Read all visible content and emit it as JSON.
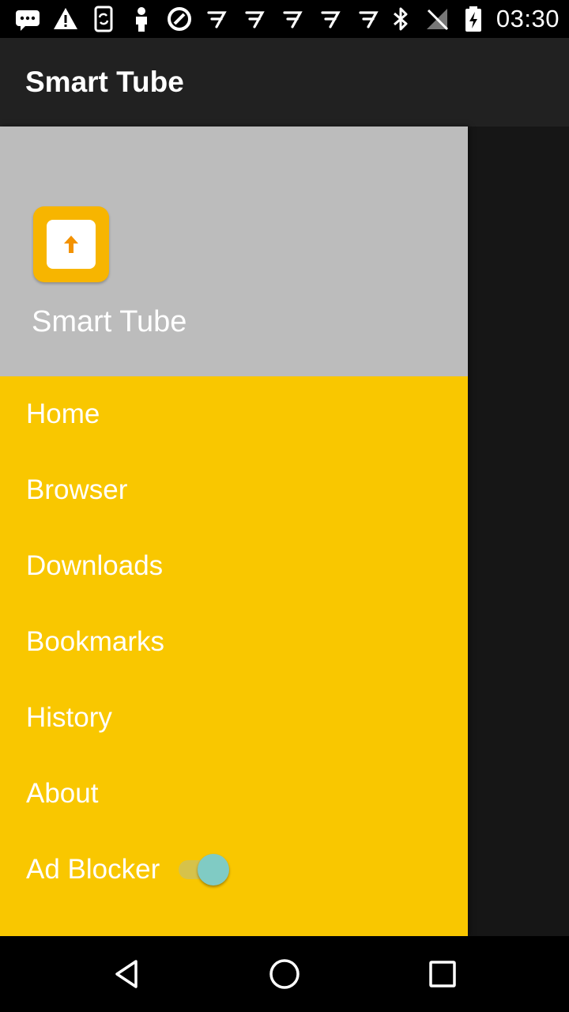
{
  "status_bar": {
    "time": "03:30",
    "left_icons": [
      "message-icon",
      "warning-icon",
      "phone-sync-icon",
      "person-icon",
      "blocked-icon",
      "notification-7-icon",
      "notification-7-icon",
      "notification-7-icon",
      "notification-7-icon",
      "notification-7-icon"
    ],
    "right_icons": [
      "bluetooth-icon",
      "no-signal-icon",
      "battery-charging-icon"
    ]
  },
  "app_bar": {
    "title": "Smart Tube"
  },
  "drawer": {
    "header": {
      "app_name": "Smart Tube",
      "logo": "smart-tube-logo-icon"
    },
    "items": [
      {
        "label": "Home"
      },
      {
        "label": "Browser"
      },
      {
        "label": "Downloads"
      },
      {
        "label": "Bookmarks"
      },
      {
        "label": "History"
      },
      {
        "label": "About"
      },
      {
        "label": "Ad Blocker",
        "toggle": true,
        "toggle_on": true
      }
    ]
  },
  "nav_bar": {
    "buttons": [
      "back-icon",
      "home-icon",
      "recents-icon"
    ]
  },
  "colors": {
    "drawer_bg": "#f9c700",
    "header_bg": "#bcbcbc",
    "app_bar_bg": "#212121",
    "scrim_bg": "#161616",
    "toggle_thumb": "#80cbc4",
    "logo_bg": "#f7b500",
    "logo_arrow": "#f39200"
  }
}
